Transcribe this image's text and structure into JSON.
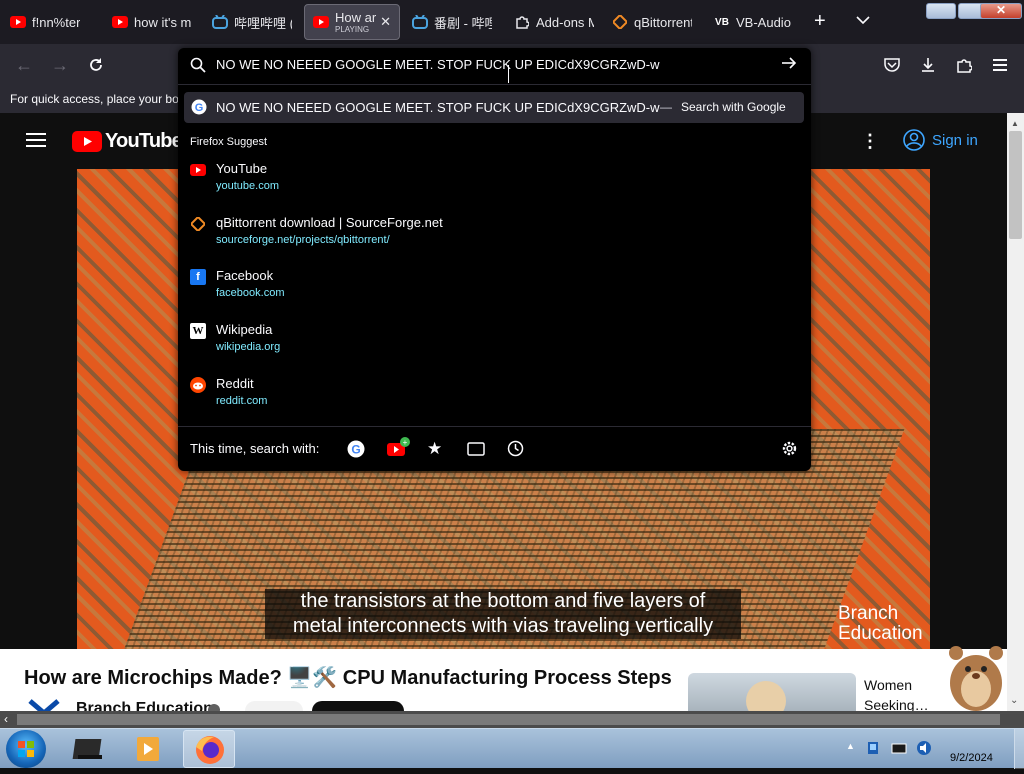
{
  "tabs": [
    {
      "label": "f!nn%ter",
      "icon": "youtube-icon"
    },
    {
      "label": "how it's m",
      "icon": "youtube-icon"
    },
    {
      "label": "哔哩哔哩 (",
      "icon": "bilibili-icon"
    },
    {
      "label": "How are",
      "sub": "PLAYING",
      "icon": "youtube-icon",
      "active": true
    },
    {
      "label": "番剧 - 哔哩",
      "icon": "bilibili-icon"
    },
    {
      "label": "Add-ons M",
      "icon": "puzzle-icon"
    },
    {
      "label": "qBittorrent",
      "icon": "qbittorrent-icon"
    },
    {
      "label": "VB-Audio V",
      "icon": "vb-audio-icon"
    }
  ],
  "url": {
    "value": "NO WE NO NEEED GOOGLE MEET. STOP FUCK UP EDICdX9CGRZwD-w",
    "first_suggestion": "NO WE NO NEEED GOOGLE MEET. STOP FUCK UP EDICdX9CGRZwD-w",
    "search_with": "Search with Google",
    "group_label": "Firefox Suggest",
    "suggestions": [
      {
        "title": "YouTube",
        "url": "youtube.com",
        "icon": "youtube-icon"
      },
      {
        "title": "qBittorrent download | SourceForge.net",
        "url": "sourceforge.net/projects/qbittorrent/",
        "icon": "qbittorrent-icon"
      },
      {
        "title": "Facebook",
        "url": "facebook.com",
        "icon": "facebook-icon"
      },
      {
        "title": "Wikipedia",
        "url": "wikipedia.org",
        "icon": "wikipedia-icon"
      },
      {
        "title": "Reddit",
        "url": "reddit.com",
        "icon": "reddit-icon"
      }
    ],
    "this_time": "This time, search with:"
  },
  "bookmarks_hint": "For quick access, place your boo",
  "youtube": {
    "logo_text": "YouTube",
    "sign_in": "Sign in",
    "caption_line1": "the transistors at the bottom and five layers of",
    "caption_line2": "metal interconnects with vias traveling vertically",
    "brand_line1": "Branch",
    "brand_line2": "Education",
    "video_title": "How are Microchips Made? 🖥️🛠️ CPU Manufacturing Process Steps",
    "channel": "Branch Education",
    "ad_line1": "Women",
    "ad_line2": "Seeking…"
  },
  "taskbar": {
    "date": "9/2/2024"
  },
  "colors": {
    "youtube_red": "#ff0000",
    "link_cyan": "#80ebff",
    "signin_blue": "#3ea6ff"
  }
}
